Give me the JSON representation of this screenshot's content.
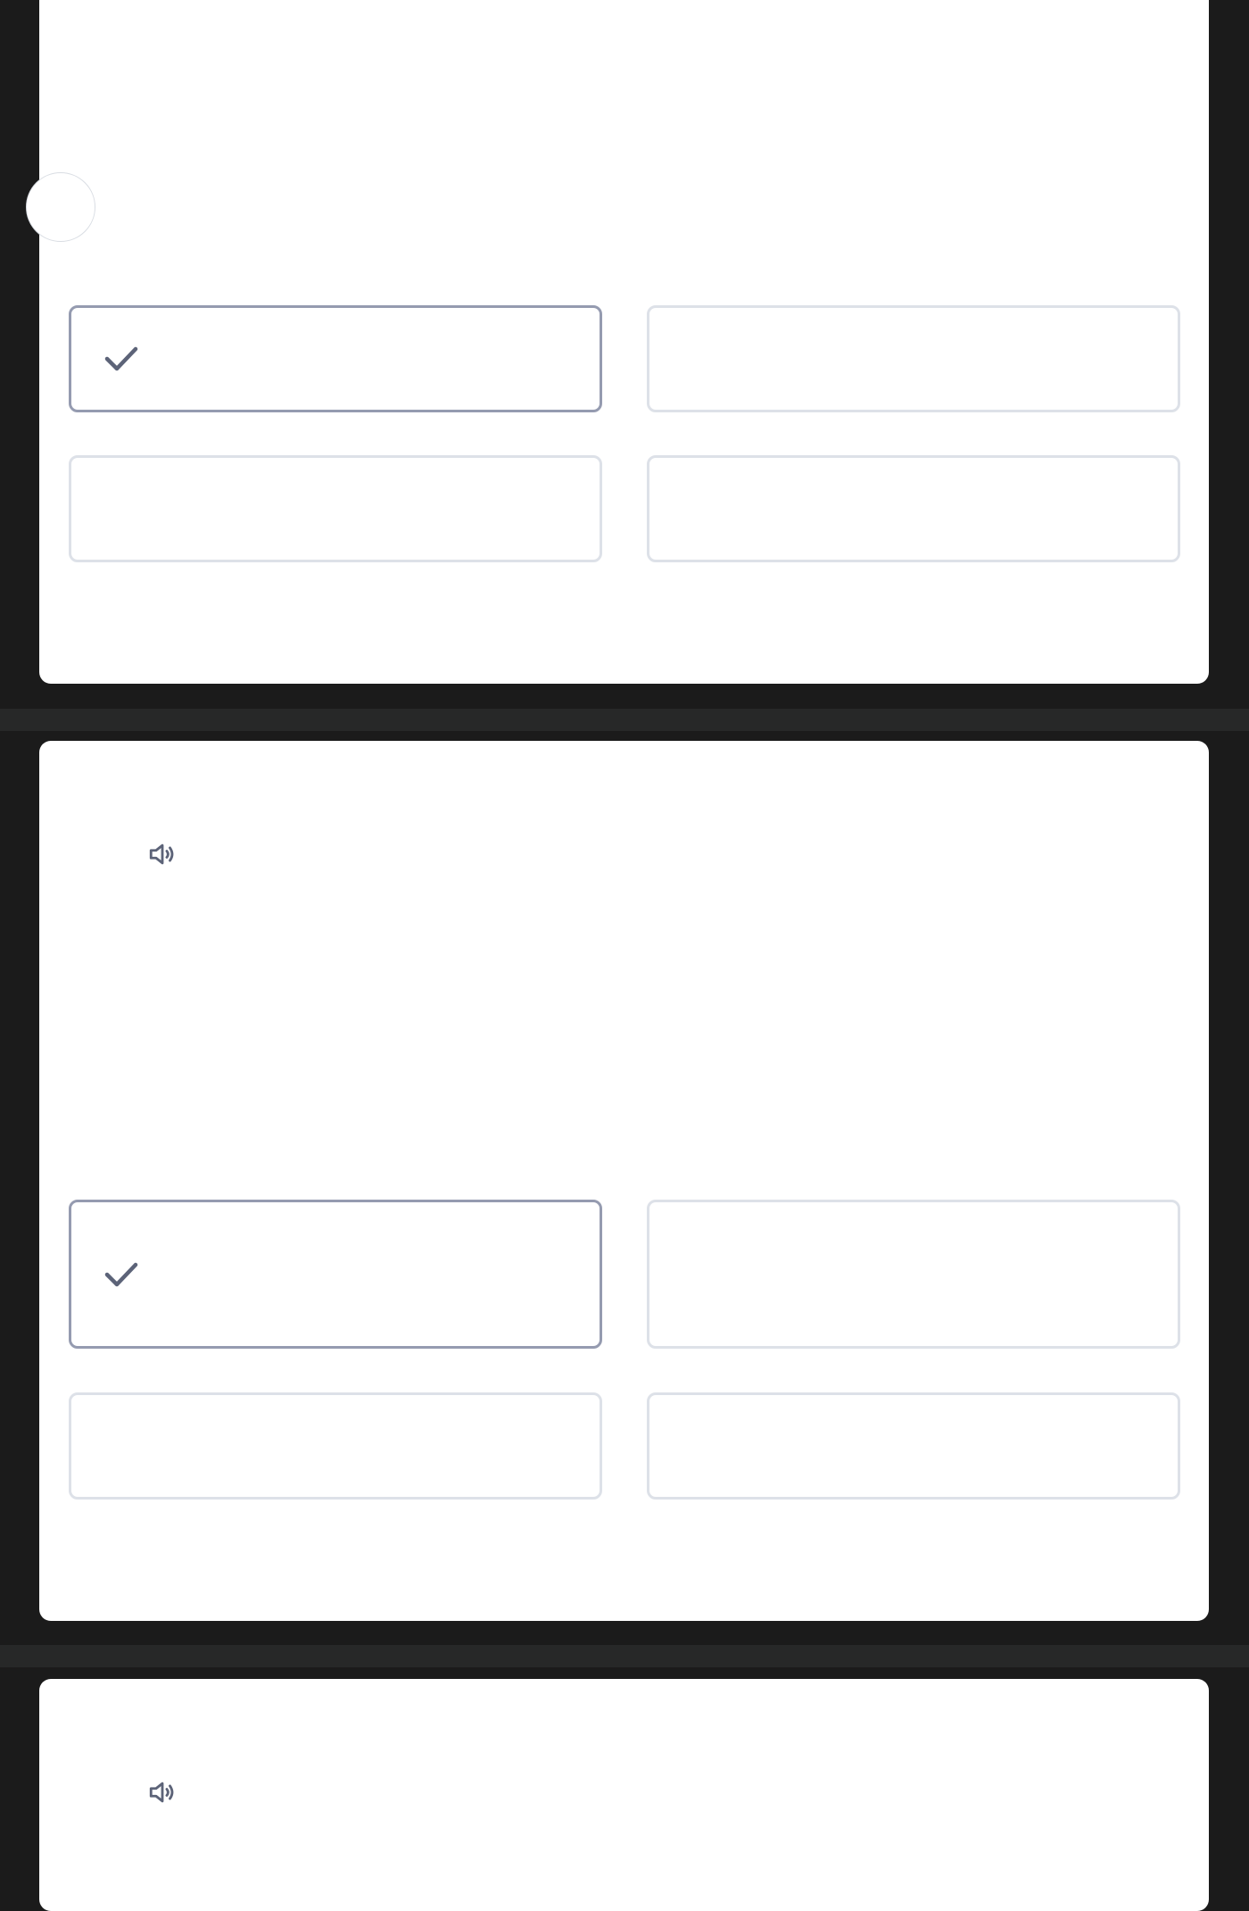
{
  "colors": {
    "page_background": "#1b1b1b",
    "separator": "#272828",
    "card_background": "#ffffff",
    "option_border": "#dde1e8",
    "option_selected_border": "#959bb0",
    "icon": "#5c6378"
  },
  "cards": [
    {
      "options": [
        {
          "selected": true,
          "icon": "checkmark-icon",
          "label": ""
        },
        {
          "selected": false,
          "label": ""
        },
        {
          "selected": false,
          "label": ""
        },
        {
          "selected": false,
          "label": ""
        }
      ]
    },
    {
      "audio_icon": "speaker-icon",
      "prompt": "",
      "options": [
        {
          "selected": true,
          "icon": "checkmark-icon",
          "label": ""
        },
        {
          "selected": false,
          "label": ""
        },
        {
          "selected": false,
          "label": ""
        },
        {
          "selected": false,
          "label": ""
        }
      ]
    },
    {
      "audio_icon": "speaker-icon",
      "prompt": ""
    }
  ]
}
